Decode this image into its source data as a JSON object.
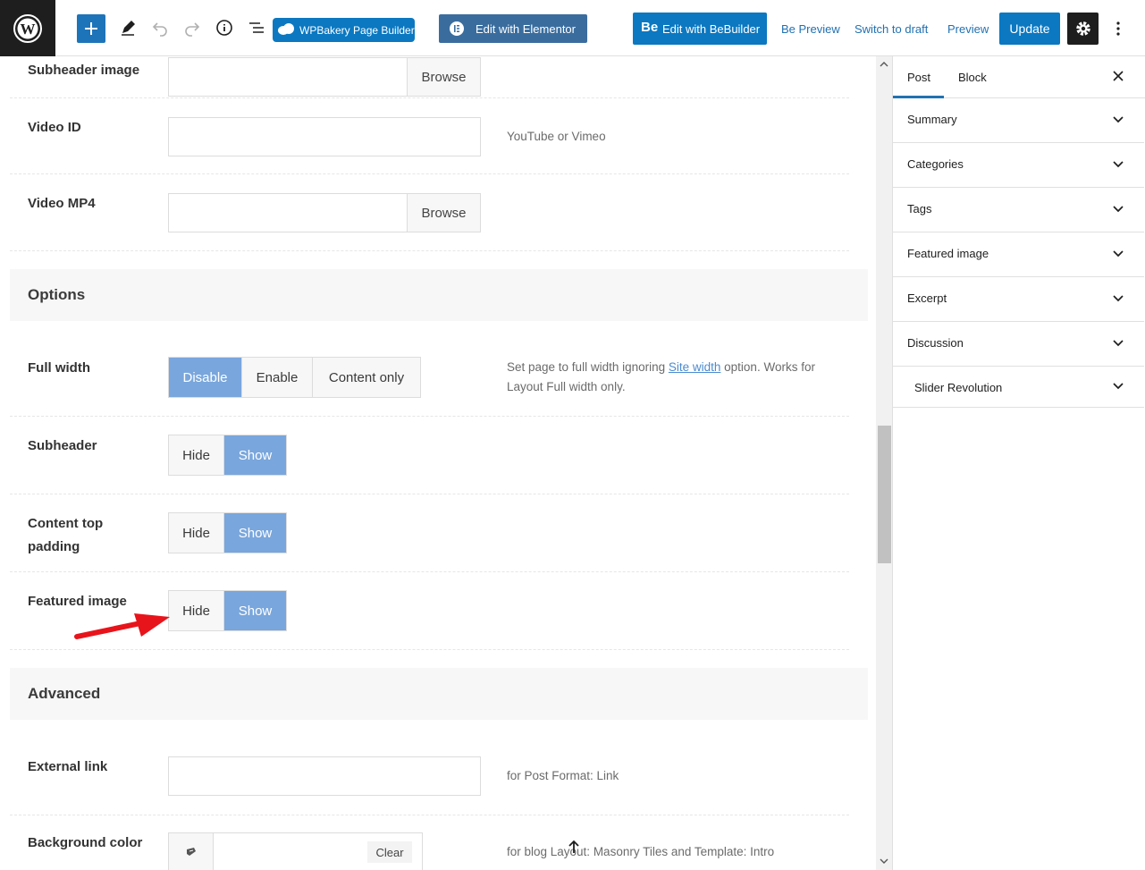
{
  "toolbar": {
    "wpbakery_label": "WPBakery Page Builder",
    "elementor_label": "Edit with Elementor",
    "bebuilder_label": "Edit with BeBuilder",
    "bebuilder_logo": "Be",
    "be_preview_label": "Be Preview",
    "switch_draft_label": "Switch to draft",
    "preview_label": "Preview",
    "update_label": "Update"
  },
  "main": {
    "subheader_image_label": "Subheader image",
    "browse_label": "Browse",
    "video_id_label": "Video ID",
    "video_id_desc": "YouTube or Vimeo",
    "video_mp4_label": "Video MP4",
    "options_section": "Options",
    "full_width_label": "Full width",
    "full_width_options": [
      "Disable",
      "Enable",
      "Content only"
    ],
    "full_width_desc_pre": "Set page to full width ignoring ",
    "full_width_desc_link": "Site width",
    "full_width_desc_post": " option. Works for Layout Full width only.",
    "subheader_label": "Subheader",
    "content_top_padding_label": "Content top padding",
    "featured_image_label": "Featured image",
    "hide_label": "Hide",
    "show_label": "Show",
    "advanced_section": "Advanced",
    "external_link_label": "External link",
    "external_link_desc": "for Post Format: Link",
    "background_color_label": "Background color",
    "clear_label": "Clear",
    "background_color_desc": "for blog Layout: Masonry Tiles and Template: Intro"
  },
  "sidebar": {
    "tab_post": "Post",
    "tab_block": "Block",
    "panels": [
      "Summary",
      "Categories",
      "Tags",
      "Featured image",
      "Excerpt",
      "Discussion",
      "Slider Revolution"
    ]
  },
  "colors": {
    "accent": "#2271b1",
    "active_segment": "#79a6dc",
    "annotation": "#e8141b"
  }
}
